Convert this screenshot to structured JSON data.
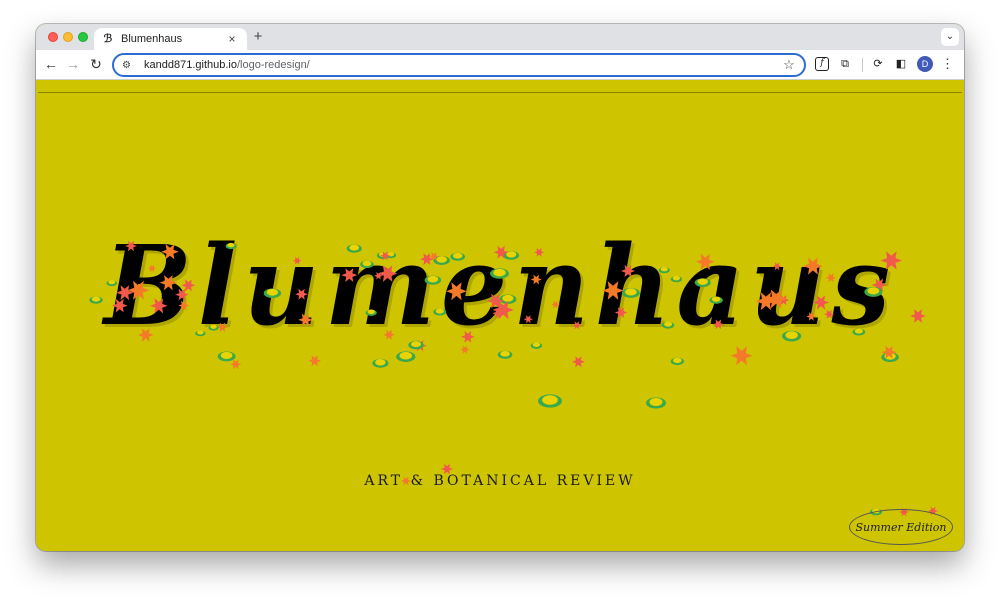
{
  "browser": {
    "tab": {
      "title": "Blumenhaus",
      "close": "×"
    },
    "new_tab": "+",
    "tab_search": "⌄",
    "nav": {
      "back": "←",
      "forward": "→",
      "reload": "↻"
    },
    "omnibox": {
      "host": "kandd871.github.io",
      "path": "/logo-redesign/",
      "star": "☆"
    },
    "extensions": {
      "ext1": "f",
      "ext2": "⧉",
      "ext3": "⟳",
      "sidepanel": "◧"
    },
    "profile_initial": "D",
    "menu": "⋮"
  },
  "page": {
    "logo": "Blumenhaus",
    "subtitle": "ART & BOTANICAL REVIEW",
    "badge": "Summer Edition",
    "background_color": "#cec500",
    "flower_colors": [
      "#f15a4a",
      "#f47a2a",
      "#e9d300",
      "#3aa84b"
    ]
  }
}
